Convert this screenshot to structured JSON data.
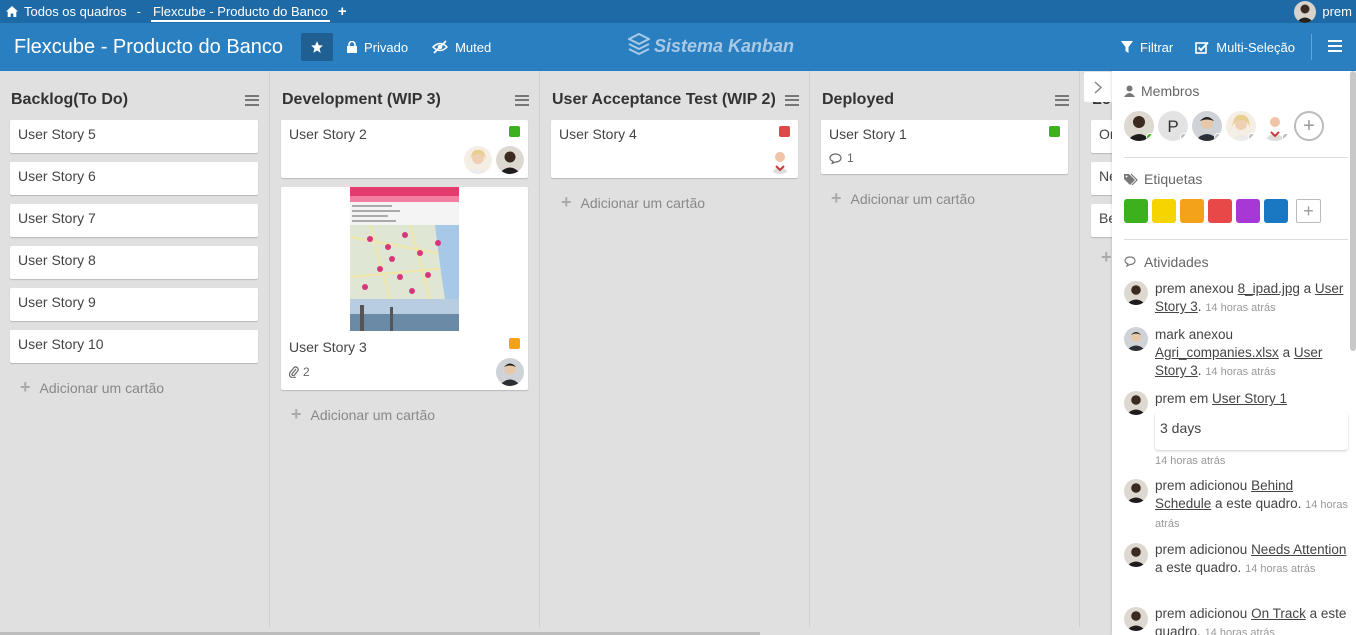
{
  "topbar": {
    "home_label": "Todos os quadros",
    "separator": "-",
    "active_board_tab": "Flexcube - Producto do Banco",
    "user_name": "prem"
  },
  "header": {
    "board_title": "Flexcube - Producto do Banco",
    "privacy_label": "Privado",
    "mute_label": "Muted",
    "logo_text": "Sistema Kanban",
    "filter_label": "Filtrar",
    "multiselect_label": "Multi-Seleção"
  },
  "colors": {
    "topbar": "#1e6aa6",
    "header": "#2a7fc0",
    "board_bg": "#e0e0e0",
    "label_green": "#3cb01d",
    "label_red": "#e04848",
    "label_orange": "#f5a21b"
  },
  "columns": [
    {
      "title": "Backlog(To Do)",
      "cards": [
        {
          "title": "User Story 5"
        },
        {
          "title": "User Story 6"
        },
        {
          "title": "User Story 7"
        },
        {
          "title": "User Story 8"
        },
        {
          "title": "User Story 9"
        },
        {
          "title": "User Story 10"
        }
      ],
      "add_label": "Adicionar um cartão"
    },
    {
      "title": "Development (WIP 3)",
      "cards": [
        {
          "title": "User Story 2",
          "label_color": "green"
        },
        {
          "title": "User Story 3",
          "label_color": "orange",
          "attachments": "2"
        }
      ],
      "add_label": "Adicionar um cartão"
    },
    {
      "title": "User Acceptance Test (WIP 2)",
      "cards": [
        {
          "title": "User Story 4",
          "label_color": "red"
        }
      ],
      "add_label": "Adicionar um cartão"
    },
    {
      "title": "Deployed",
      "cards": [
        {
          "title": "User Story 1",
          "label_color": "green",
          "comments": "1"
        }
      ],
      "add_label": "Adicionar um cartão"
    },
    {
      "title": "Le",
      "cards": [
        {
          "title": "Or"
        },
        {
          "title": "Ne"
        },
        {
          "title": "Be"
        }
      ]
    }
  ],
  "panel": {
    "members_title": "Membros",
    "member_initial": "P",
    "labels_title": "Etiquetas",
    "label_swatches": [
      "#3cb01d",
      "#f5d400",
      "#f5a21b",
      "#e84848",
      "#a838d6",
      "#1a78c2"
    ],
    "activities_title": "Atividades",
    "activities": [
      {
        "pre": "prem anexou ",
        "link1": "8_ipad.jpg",
        "mid": " a ",
        "link2": "User Story 3",
        "post": ".",
        "time": "14 horas atrás"
      },
      {
        "pre": "mark anexou ",
        "link1": "Agri_companies.xlsx",
        "mid": " a ",
        "link2": "User Story 3",
        "post": ".",
        "time": "14 horas atrás"
      },
      {
        "pre": "prem em ",
        "link1": "User Story 1",
        "mid": "",
        "link2": "",
        "post": "",
        "time": "14 horas atrás",
        "comment": "3 days"
      },
      {
        "pre": "prem adicionou ",
        "link1": "Behind Schedule",
        "mid": "",
        "link2": "",
        "post": " a este quadro.",
        "time": "14 horas atrás"
      },
      {
        "pre": "prem adicionou ",
        "link1": "Needs Attention",
        "mid": "",
        "link2": "",
        "post": " a este quadro.",
        "time": "14 horas atrás"
      },
      {
        "pre": "prem adicionou ",
        "link1": "On Track",
        "mid": "",
        "link2": "",
        "post": " a este quadro.",
        "time": "14 horas atrás"
      }
    ]
  }
}
